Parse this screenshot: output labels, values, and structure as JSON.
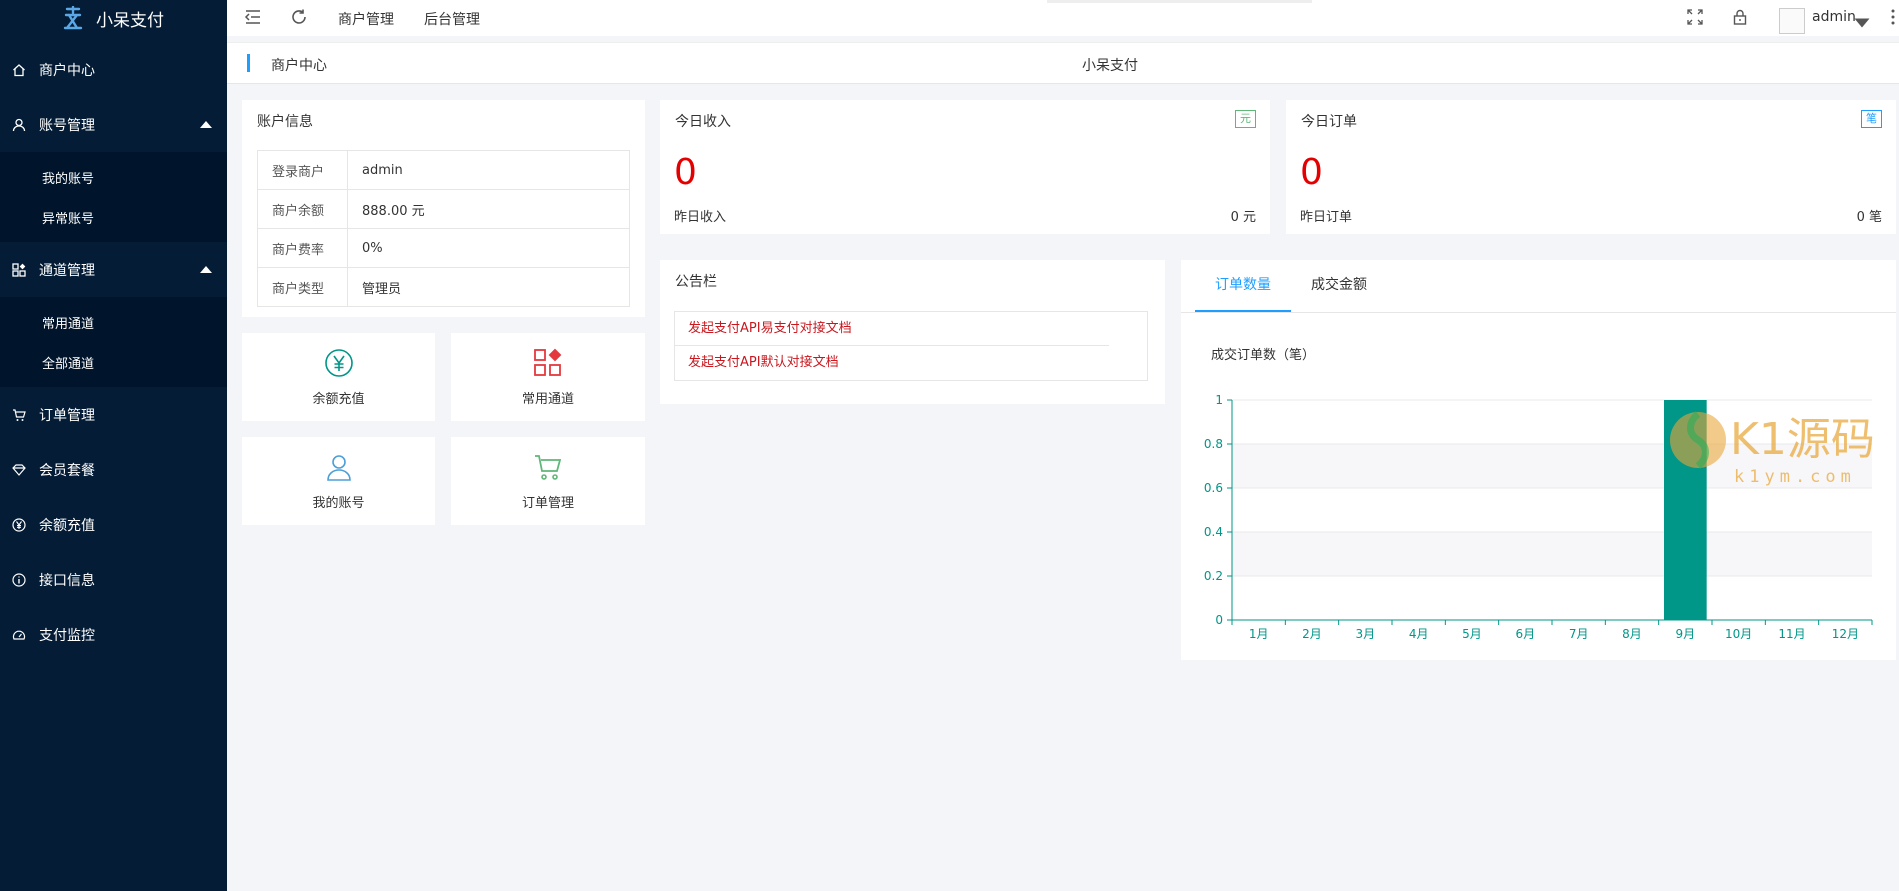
{
  "app": {
    "title": "小呆支付"
  },
  "sidebar": {
    "items": [
      {
        "label": "商户中心"
      },
      {
        "label": "账号管理",
        "children": [
          "我的账号",
          "异常账号"
        ]
      },
      {
        "label": "通道管理",
        "children": [
          "常用通道",
          "全部通道"
        ]
      },
      {
        "label": "订单管理"
      },
      {
        "label": "会员套餐"
      },
      {
        "label": "余额充值"
      },
      {
        "label": "接口信息"
      },
      {
        "label": "支付监控"
      }
    ]
  },
  "topbar": {
    "nav1": "商户管理",
    "nav2": "后台管理",
    "user": "admin"
  },
  "tabbar": {
    "current": "商户中心",
    "center": "小呆支付"
  },
  "account": {
    "title": "账户信息",
    "rows": [
      {
        "key": "登录商户",
        "value": "admin"
      },
      {
        "key": "商户余额",
        "value": "888.00 元"
      },
      {
        "key": "商户费率",
        "value": "0%"
      },
      {
        "key": "商户类型",
        "value": "管理员"
      }
    ]
  },
  "quick": {
    "recharge": "余额充值",
    "channels": "常用通道",
    "account": "我的账号",
    "orders": "订单管理"
  },
  "income": {
    "title": "今日收入",
    "badge": "元",
    "value": "0",
    "footer_label": "昨日收入",
    "footer_value": "0 元",
    "badge_color": "#5fb878"
  },
  "orders_today": {
    "title": "今日订单",
    "badge": "笔",
    "value": "0",
    "footer_label": "昨日订单",
    "footer_value": "0 笔",
    "badge_color": "#1e9fff"
  },
  "notice": {
    "title": "公告栏",
    "items": [
      "发起支付API易支付对接文档",
      "发起支付API默认对接文档"
    ]
  },
  "chart_tabs": {
    "tab1": "订单数量",
    "tab2": "成交金额"
  },
  "chart_data": {
    "type": "bar",
    "title": "成交订单数（笔）",
    "categories": [
      "1月",
      "2月",
      "3月",
      "4月",
      "5月",
      "6月",
      "7月",
      "8月",
      "9月",
      "10月",
      "11月",
      "12月"
    ],
    "values": [
      0,
      0,
      0,
      0,
      0,
      0,
      0,
      0,
      1,
      0,
      0,
      0
    ],
    "ylim": [
      0,
      1
    ],
    "yticks": [
      "0",
      "0.2",
      "0.4",
      "0.6",
      "0.8",
      "1"
    ],
    "color": "#009688"
  },
  "watermark": {
    "main": "K1源码",
    "sub": "k1ym.com"
  }
}
